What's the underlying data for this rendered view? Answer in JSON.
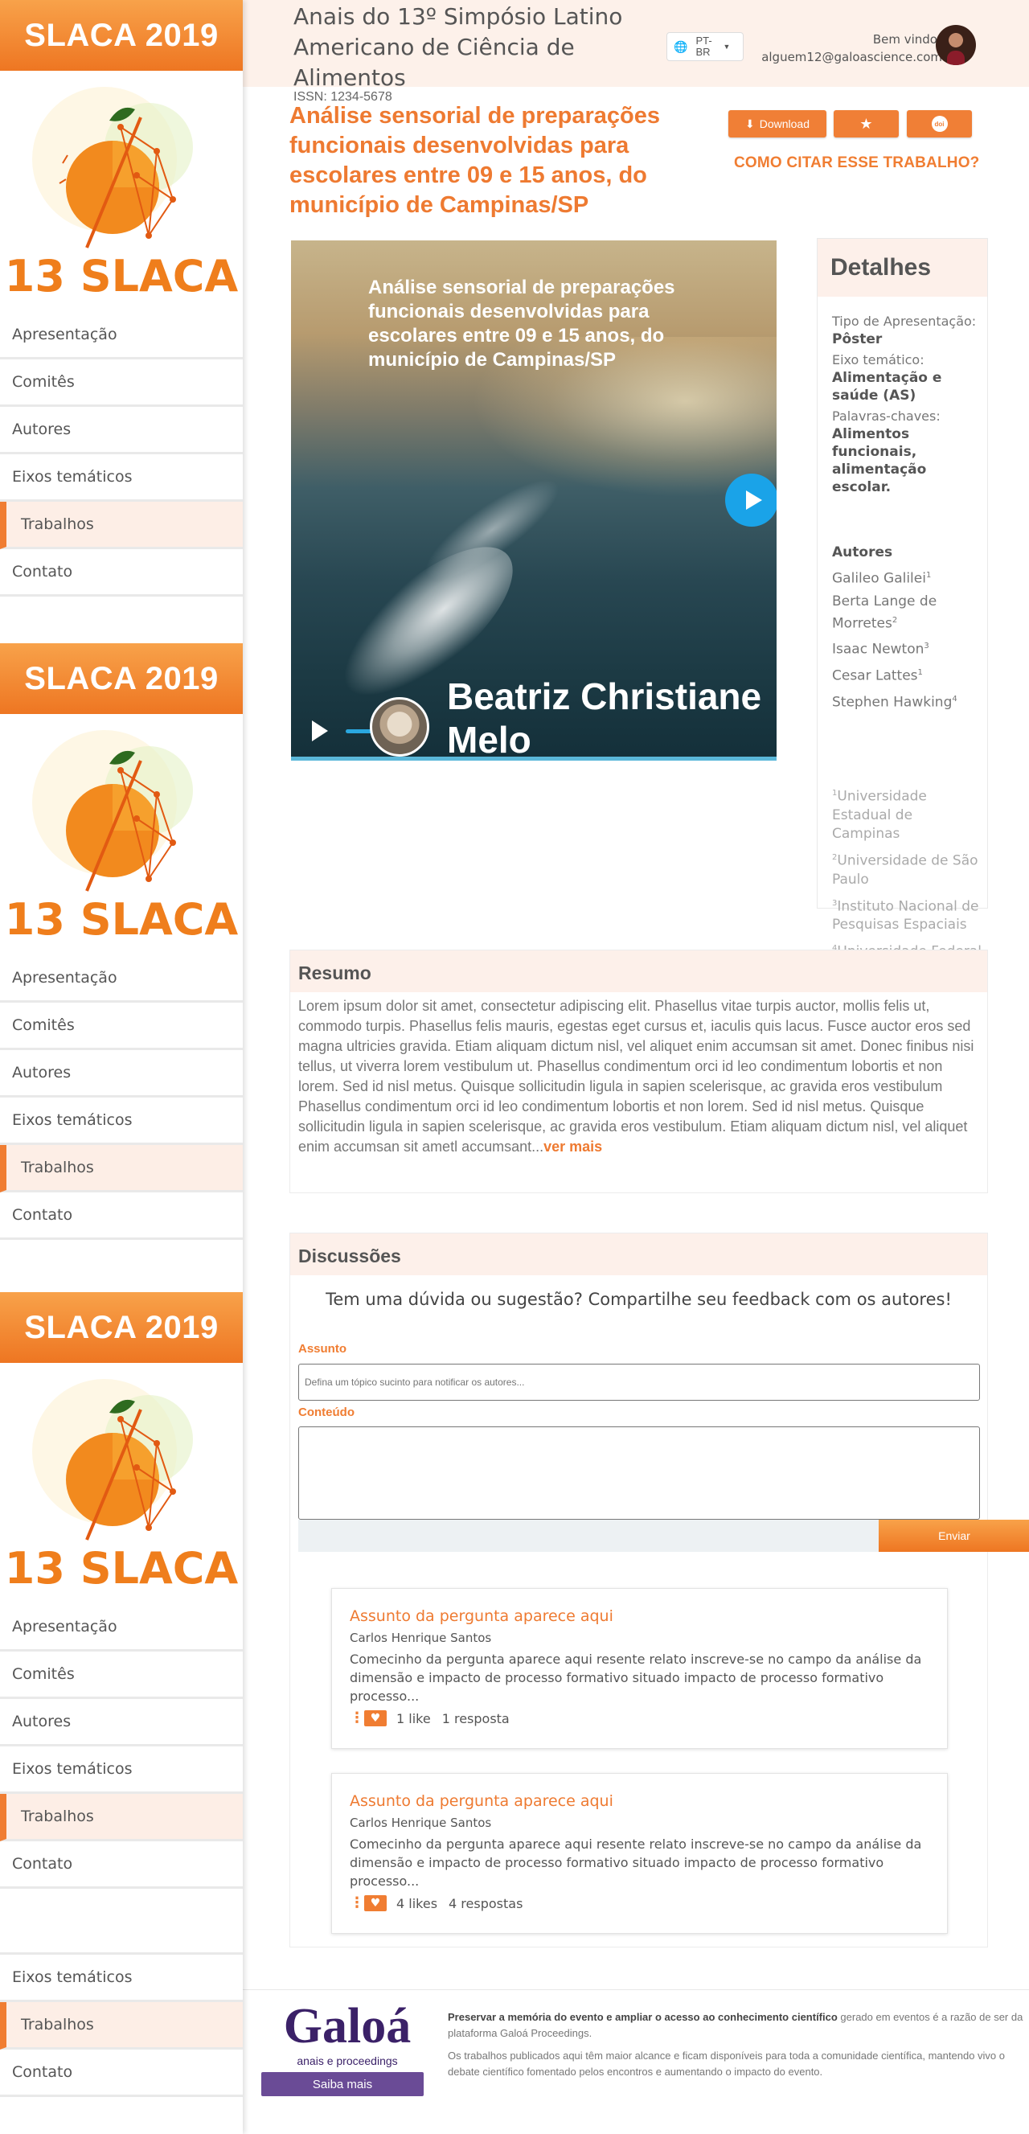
{
  "sidebar": {
    "banner": "SLACA 2019",
    "logo_text": "13 SLACA",
    "items": [
      {
        "label": "Apresentação"
      },
      {
        "label": "Comitês"
      },
      {
        "label": "Autores"
      },
      {
        "label": "Eixos temáticos"
      },
      {
        "label": "Trabalhos",
        "active": true
      },
      {
        "label": "Contato"
      }
    ],
    "tail_items": [
      {
        "label": "Eixos temáticos"
      },
      {
        "label": "Trabalhos",
        "active": true
      },
      {
        "label": "Contato"
      }
    ]
  },
  "header": {
    "event_title": "Anais do 13º Simpósio Latino Americano de Ciência de Alimentos",
    "issn": "ISSN: 1234-5678",
    "language": "PT-BR",
    "welcome": "Bem vindo!",
    "email": "alguem12@galoascience.com"
  },
  "paper": {
    "title": "Análise sensorial de preparações funcionais desenvolvidas para escolares entre 09 e 15 anos, do município de Campinas/SP",
    "download_label": "Download",
    "doi_label": "doi",
    "cite_label": "COMO CITAR ESSE TRABALHO?"
  },
  "video": {
    "title": "Análise sensorial de preparações funcionais desenvolvidas para escolares entre 09 e 15 anos, do município de Campinas/SP",
    "speaker": "Beatriz Christiane Melo"
  },
  "details": {
    "heading": "Detalhes",
    "type_label": "Tipo de Apresentação:",
    "type_value": "Pôster",
    "axis_label": "Eixo temático:",
    "axis_value": "Alimentação e saúde (AS)",
    "keywords_label": "Palavras-chaves:",
    "keywords_value": "Alimentos funcionais, alimentação escolar.",
    "authors_heading": "Autores",
    "authors": [
      {
        "name": "Galileo Galilei",
        "sup": "1"
      },
      {
        "name": "Berta Lange de Morretes",
        "sup": "2"
      },
      {
        "name": "Isaac Newton",
        "sup": "3"
      },
      {
        "name": "Cesar Lattes",
        "sup": "1"
      },
      {
        "name": "Stephen Hawking",
        "sup": "4"
      }
    ],
    "affiliations": [
      {
        "sup": "1",
        "name": "Universidade Estadual de Campinas"
      },
      {
        "sup": "2",
        "name": "Universidade de São Paulo"
      },
      {
        "sup": "3",
        "name": "Instituto Nacional de Pesquisas Espaciais"
      },
      {
        "sup": "4",
        "name": "Universidade Federal do Rio de Janeiro"
      }
    ]
  },
  "resumo": {
    "heading": "Resumo",
    "text": "Lorem ipsum dolor sit amet, consectetur adipiscing elit. Phasellus vitae turpis auctor, mollis felis ut, commodo turpis. Phasellus felis mauris, egestas eget cursus et, iaculis quis lacus. Fusce auctor eros sed magna ultricies gravida. Etiam aliquam dictum nisl, vel aliquet enim accumsan sit amet. Donec finibus nisi tellus, ut viverra lorem vestibulum ut. Phasellus condimentum orci id leo condimentum lobortis et non lorem. Sed id nisl metus. Quisque sollicitudin ligula in sapien scelerisque, ac gravida eros vestibulum Phasellus condimentum orci id leo condimentum lobortis et non lorem. Sed id nisl metus. Quisque sollicitudin ligula in sapien scelerisque, ac gravida eros vestibulum. Etiam aliquam dictum nisl, vel aliquet enim accumsan sit ametl accumsant...",
    "more": "ver mais"
  },
  "discussions": {
    "heading": "Discussões",
    "prompt": "Tem uma dúvida ou sugestão? Compartilhe seu feedback com os autores!",
    "subject_label": "Assunto",
    "subject_placeholder": "Defina um tópico sucinto para notificar os autores...",
    "content_label": "Conteúdo",
    "send_label": "Enviar",
    "questions": [
      {
        "title": "Assunto da pergunta aparece aqui",
        "author": "Carlos Henrique Santos",
        "body": "Comecinho da pergunta aparece aqui resente relato inscreve-se no campo da análise da dimensão e impacto de processo formativo situado impacto de processo formativo processo...",
        "likes": "1 like",
        "replies": "1 resposta"
      },
      {
        "title": "Assunto da pergunta aparece aqui",
        "author": "Carlos Henrique Santos",
        "body": "Comecinho da pergunta aparece aqui resente relato inscreve-se no campo da análise da dimensão e impacto de processo formativo situado impacto de processo formativo processo...",
        "likes": "4 likes",
        "replies": "4 respostas"
      }
    ]
  },
  "footer": {
    "brand": "Galoá",
    "brand_sub": "anais e proceedings",
    "cta": "Saiba mais",
    "p1_bold": "Preservar a memória do evento e ampliar o acesso ao conhecimento científico",
    "p1_rest": " gerado em eventos é a razão de ser da plataforma Galoá Proceedings.",
    "p2": "Os trabalhos publicados aqui têm maior alcance e ficam disponíveis para toda a comunidade científica, mantendo vivo o debate científico fomentado pelos encontros e aumentando o impacto do evento."
  },
  "colors": {
    "accent": "#f07d32",
    "header_bg": "#fdf1ea",
    "brand_purple": "#3b2168"
  }
}
